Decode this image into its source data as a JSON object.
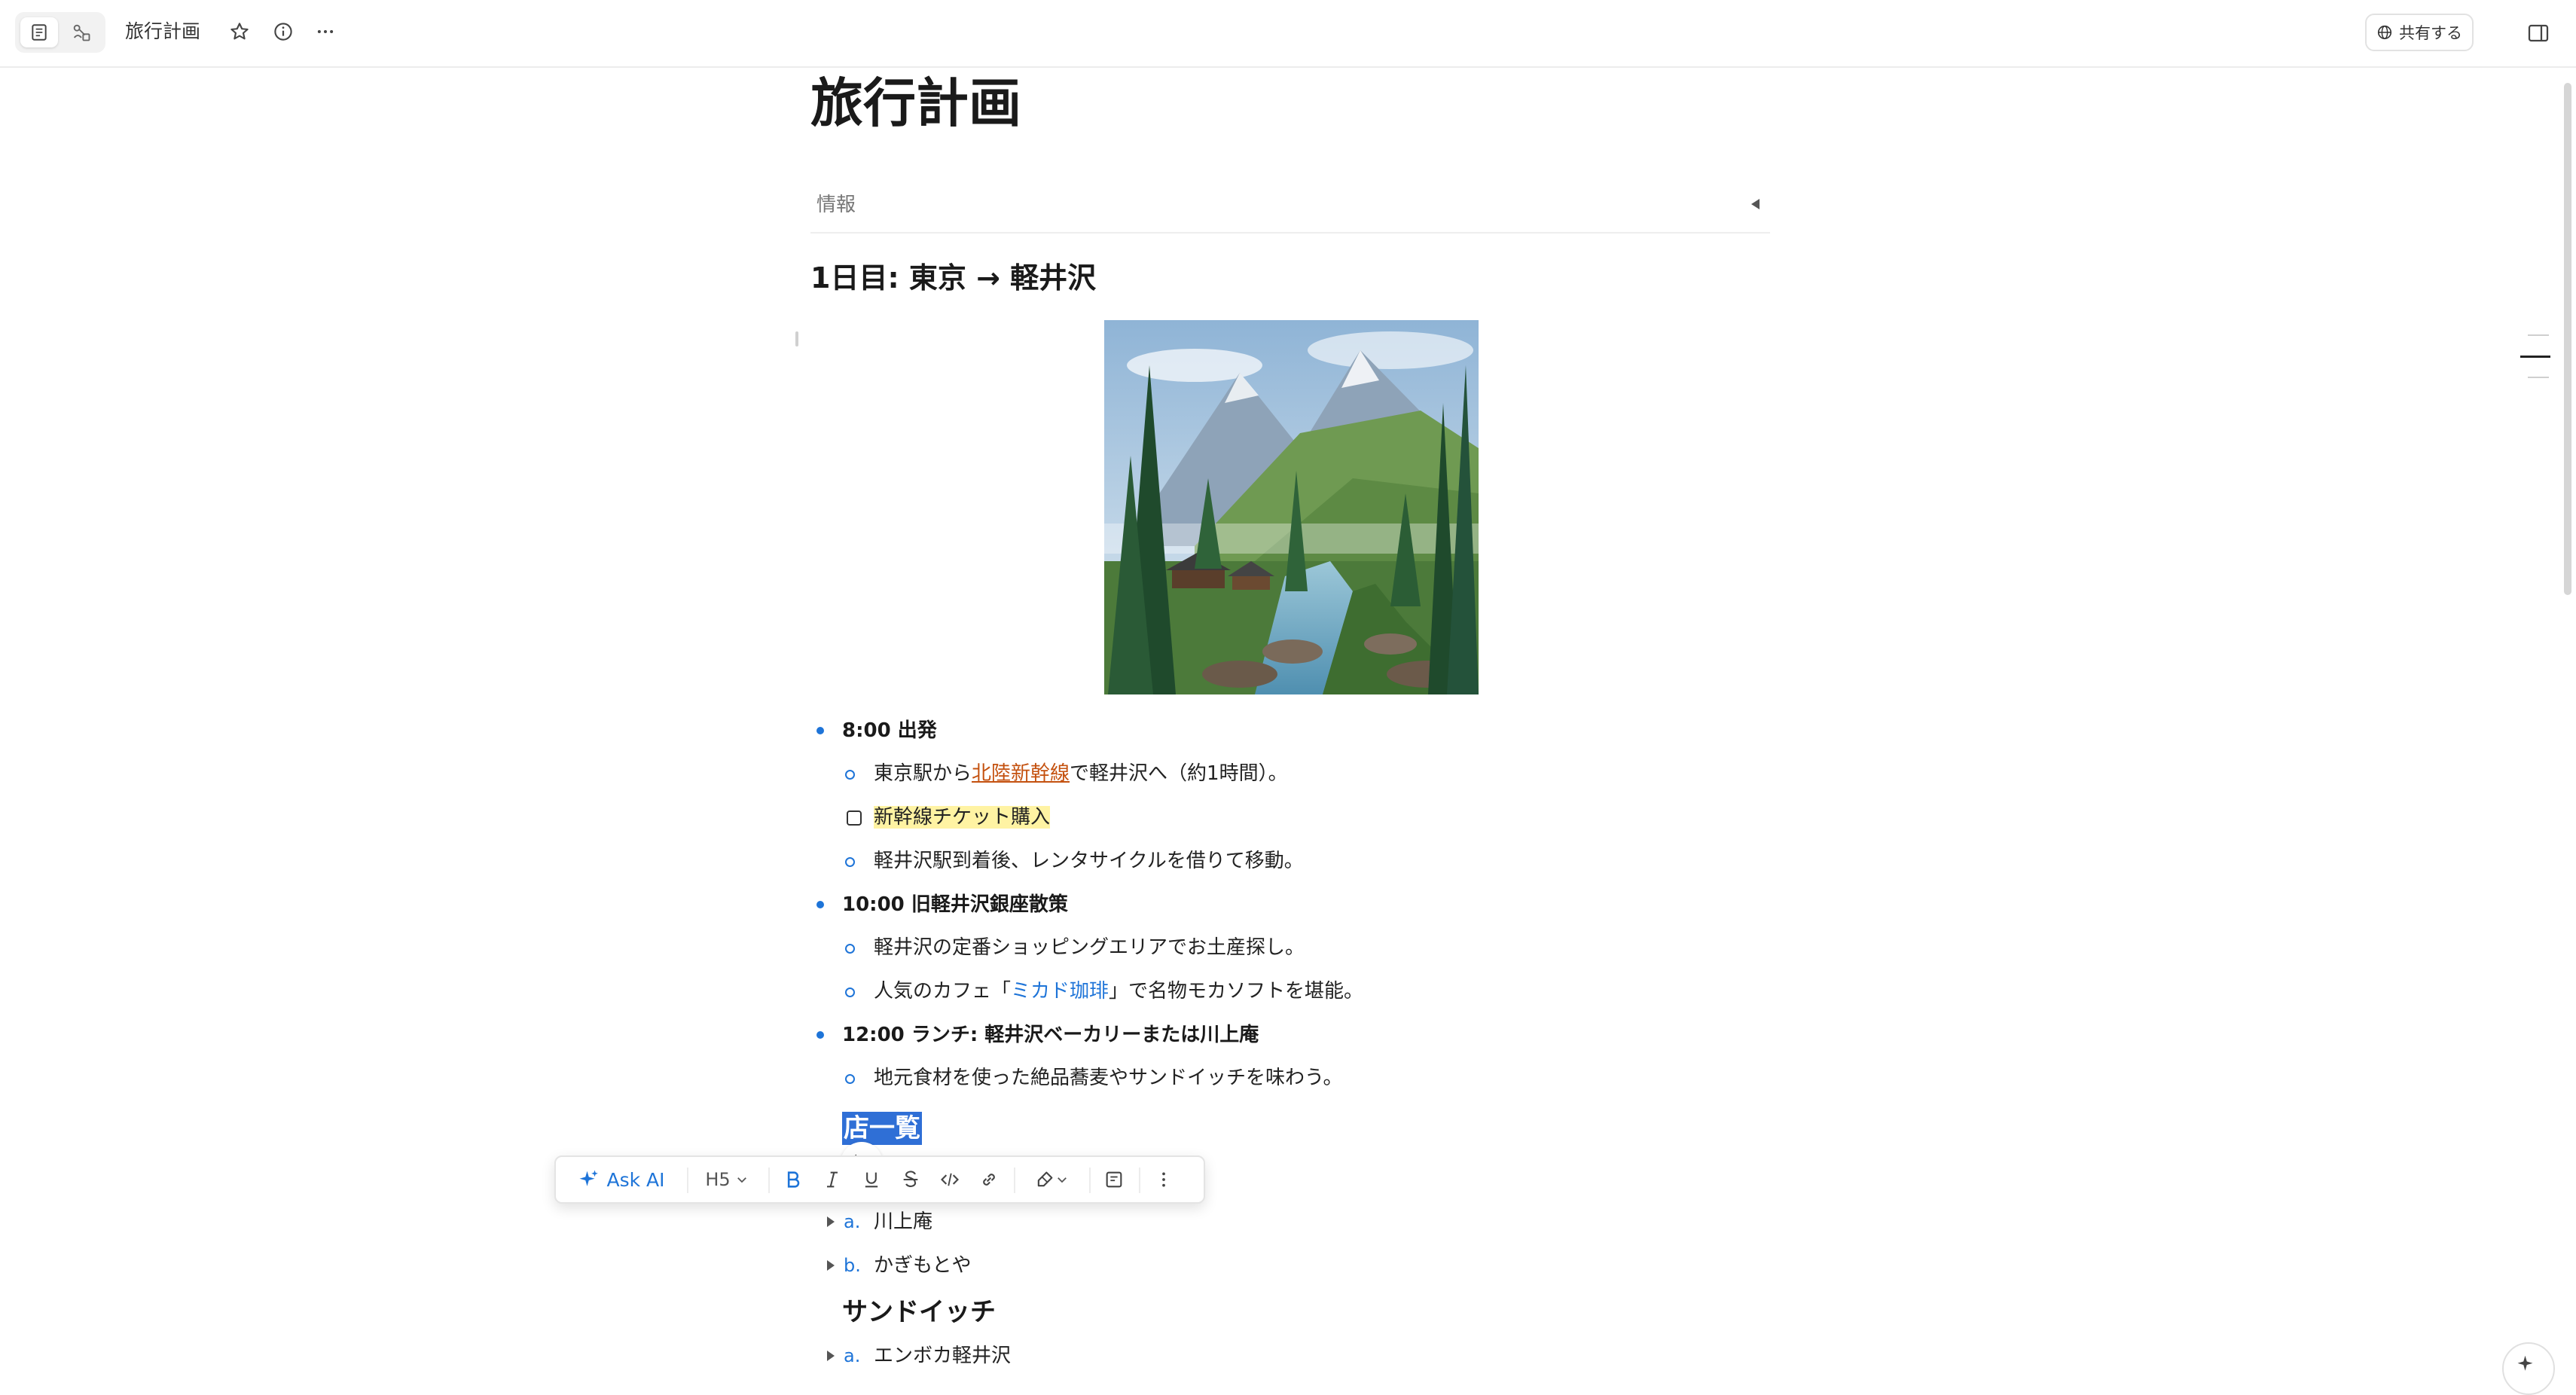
{
  "topbar": {
    "page_title": "旅行計画",
    "share_label": "共有する"
  },
  "document": {
    "title": "旅行計画",
    "info_label": "情報",
    "day1_heading": "1日目: 東京 → 軽井沢",
    "image_subject": "軽井沢の山と森と川の風景",
    "items": [
      {
        "label": "8:00 出発",
        "children": [
          {
            "type": "bullet",
            "pre": "東京駅から",
            "link": "北陸新幹線",
            "post": "で軽井沢へ（約1時間）。"
          },
          {
            "type": "todo",
            "text": "新幹線チケット購入"
          },
          {
            "type": "bullet",
            "text": "軽井沢駅到着後、レンタサイクルを借りて移動。"
          }
        ]
      },
      {
        "label": "10:00 旧軽井沢銀座散策",
        "children": [
          {
            "type": "bullet",
            "text": "軽井沢の定番ショッピングエリアでお土産探し。"
          },
          {
            "type": "bullet",
            "pre": "人気のカフェ「",
            "link": "ミカド珈琲",
            "post": "」で名物モカソフトを堪能。"
          }
        ]
      },
      {
        "label": "12:00 ランチ: 軽井沢ベーカリーまたは川上庵",
        "children": [
          {
            "type": "bullet",
            "text": "地元食材を使った絶品蕎麦やサンドイッチを味わう。"
          }
        ]
      }
    ],
    "shop_list_heading": "店一覧",
    "soba_list": [
      {
        "marker": "a.",
        "text": "川上庵"
      },
      {
        "marker": "b.",
        "text": "かぎもとや"
      }
    ],
    "sandwich_heading": "サンドイッチ",
    "sandwich_list": [
      {
        "marker": "a.",
        "text": "エンボカ軽井沢"
      }
    ]
  },
  "toolbar": {
    "ask_ai_label": "Ask AI",
    "heading_level": "H5"
  },
  "colors": {
    "accent": "#1e74d8",
    "selection": "#2f6fd6",
    "highlight": "#fff3a3",
    "link_orange": "#c4510f"
  }
}
